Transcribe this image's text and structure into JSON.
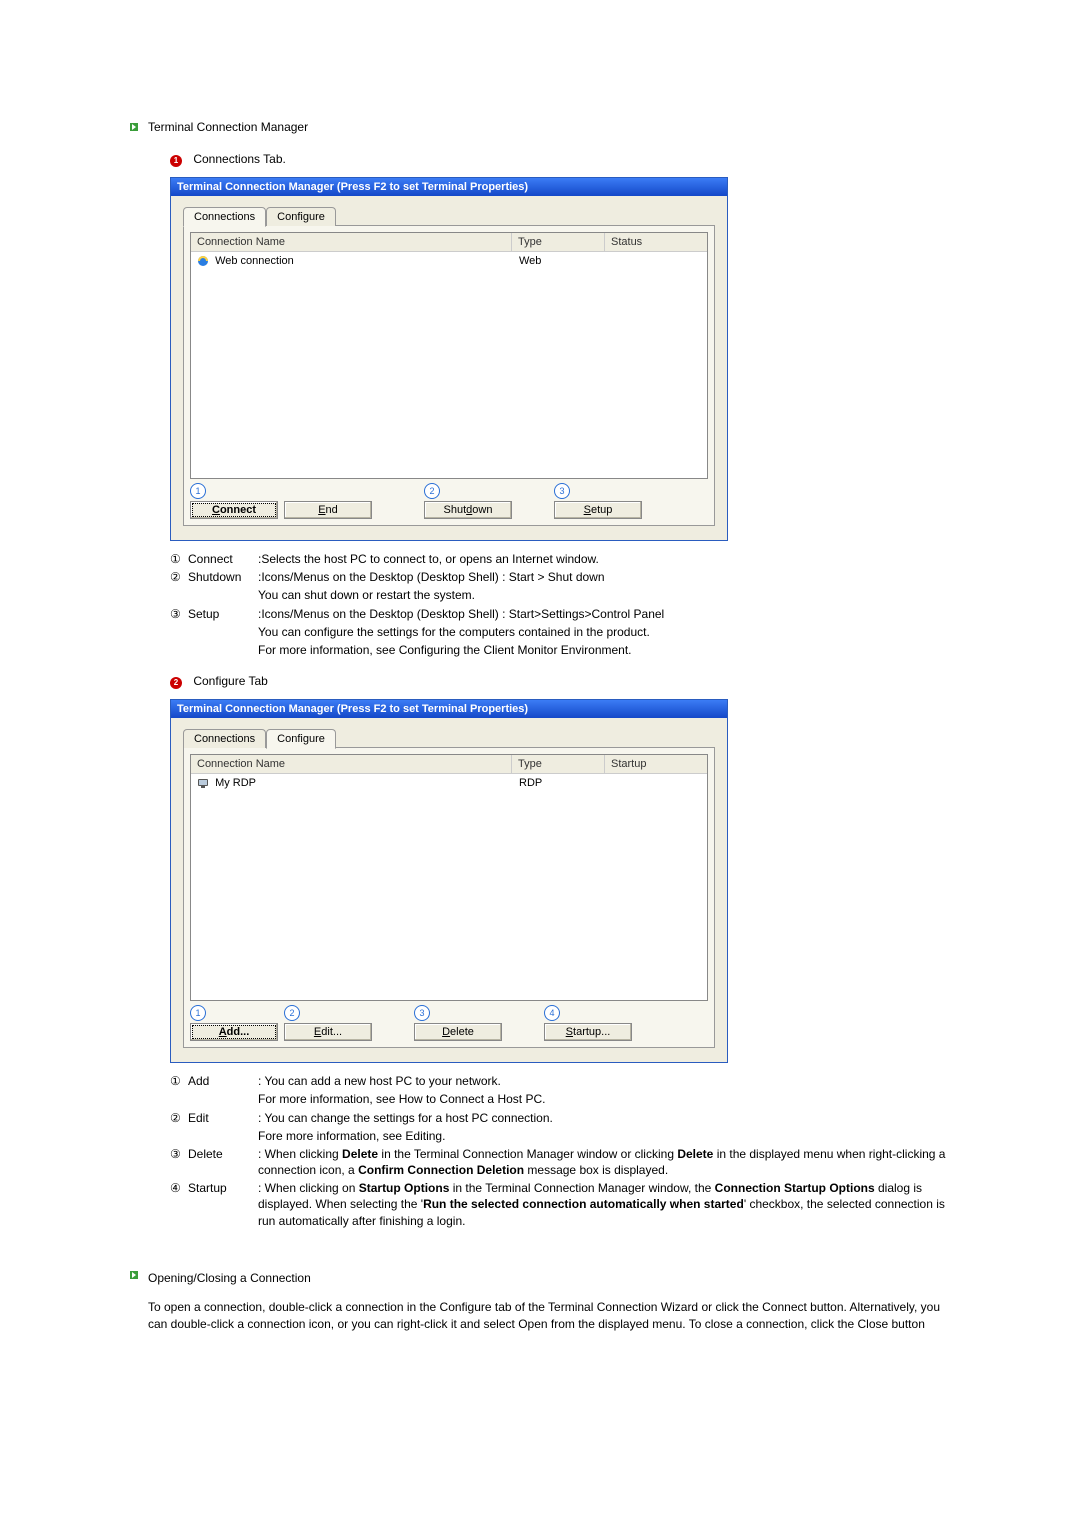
{
  "section1": {
    "title": "Terminal Connection Manager",
    "sub1": {
      "badge": "1",
      "label": "Connections Tab.",
      "window_title": "Terminal Connection Manager (Press F2 to set Terminal Properties)",
      "tabs": {
        "connections": "Connections",
        "configure": "Configure"
      },
      "columns": {
        "name": "Connection Name",
        "type": "Type",
        "status": "Status"
      },
      "row": {
        "name": "Web connection",
        "type": "Web",
        "status": ""
      },
      "nums": {
        "n1": "1",
        "n2": "2",
        "n3": "3"
      },
      "buttons": {
        "connect": "Connect",
        "end": "End",
        "shutdown": "Shutdown",
        "setup": "Setup"
      },
      "desc": {
        "n1": "①",
        "l1": "Connect",
        "t1": ":Selects the host PC to connect to, or opens an Internet window.",
        "n2": "②",
        "l2": "Shutdown",
        "t2": ":Icons/Menus on the Desktop (Desktop Shell) : Start > Shut down",
        "t2b": "You can shut down or restart the system.",
        "n3": "③",
        "l3": "Setup",
        "t3": ":Icons/Menus on the Desktop (Desktop Shell) : Start>Settings>Control Panel",
        "t3b": "You can configure the settings for the computers contained in the product.",
        "t3c": "For more information, see Configuring the Client Monitor Environment."
      }
    },
    "sub2": {
      "badge": "2",
      "label": "Configure Tab",
      "window_title": "Terminal Connection Manager (Press F2 to set Terminal Properties)",
      "tabs": {
        "connections": "Connections",
        "configure": "Configure"
      },
      "columns": {
        "name": "Connection Name",
        "type": "Type",
        "startup": "Startup"
      },
      "row": {
        "name": "My RDP",
        "type": "RDP",
        "startup": ""
      },
      "nums": {
        "n1": "1",
        "n2": "2",
        "n3": "3",
        "n4": "4"
      },
      "buttons": {
        "add": "Add...",
        "edit": "Edit...",
        "delete": "Delete",
        "startup": "Startup..."
      },
      "desc": {
        "n1": "①",
        "l1": "Add",
        "t1": ": You can add a new host PC to your network.",
        "t1b": "For more information, see How to Connect a Host PC.",
        "n2": "②",
        "l2": "Edit",
        "t2": ": You can change the settings for a host PC connection.",
        "t2b": "Fore more information, see Editing.",
        "n3": "③",
        "l3": "Delete",
        "t3a": ": When clicking ",
        "t3b": "Delete",
        "t3c": " in the Terminal Connection Manager window or clicking ",
        "t3d": "Delete",
        "t3e": " in the displayed menu when right-clicking a connection icon, a ",
        "t3f": "Confirm Connection Deletion",
        "t3g": " message box is displayed.",
        "n4": "④",
        "l4": "Startup",
        "t4a": ": When clicking on ",
        "t4b": "Startup Options",
        "t4c": " in the Terminal Connection Manager window, the ",
        "t4d": "Connection Startup Options",
        "t4e": " dialog is displayed. When selecting the '",
        "t4f": "Run the selected connection automatically when started",
        "t4g": "' checkbox, the selected connection is run automatically after finishing a login."
      }
    }
  },
  "section2": {
    "title": "Opening/Closing a Connection",
    "body": "To open a connection, double-click a connection in the Configure tab of the Terminal Connection Wizard or click the Connect button. Alternatively, you can double-click a connection icon, or you can right-click it and select Open from the displayed menu. To close a connection, click the Close button"
  }
}
